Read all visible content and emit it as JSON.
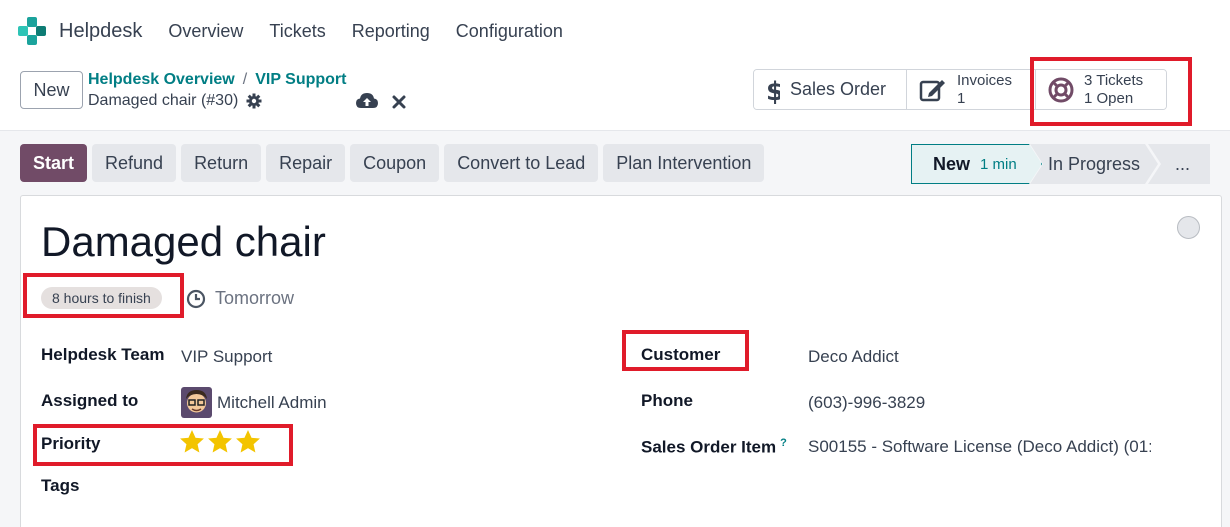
{
  "nav": {
    "app_name": "Helpdesk",
    "items": [
      "Overview",
      "Tickets",
      "Reporting",
      "Configuration"
    ]
  },
  "control": {
    "new_label": "New",
    "breadcrumb": [
      "Helpdesk Overview",
      "VIP Support"
    ],
    "breadcrumb_sep": "/",
    "record_title": "Damaged chair (#30)"
  },
  "smart_buttons": {
    "sales_order": "Sales Order",
    "invoices": {
      "label": "Invoices",
      "count": "1"
    },
    "tickets": {
      "line1": "3 Tickets",
      "line2": "1 Open"
    }
  },
  "actions": [
    "Start",
    "Refund",
    "Return",
    "Repair",
    "Coupon",
    "Convert to Lead",
    "Plan Intervention"
  ],
  "statusbar": {
    "current": {
      "label": "New",
      "duration": "1 min"
    },
    "next": "In Progress",
    "more": "..."
  },
  "ticket": {
    "name": "Damaged chair",
    "sla_badge": "8 hours to finish",
    "deadline": "Tomorrow",
    "fields_left": {
      "team_label": "Helpdesk Team",
      "team_value": "VIP Support",
      "assigned_label": "Assigned to",
      "assigned_value": "Mitchell Admin",
      "priority_label": "Priority",
      "priority_value": 3,
      "priority_max": 3,
      "tags_label": "Tags"
    },
    "fields_right": {
      "customer_label": "Customer",
      "customer_value": "Deco Addict",
      "phone_label": "Phone",
      "phone_value": "(603)-996-3829",
      "so_item_label": "Sales Order Item",
      "so_item_help": "?",
      "so_item_value": "S00155 - Software License (Deco Addict) (01:"
    }
  },
  "colors": {
    "primary": "#714b67",
    "teal": "#017e84",
    "highlight": "#e01b2a",
    "star": "#f3c400"
  }
}
